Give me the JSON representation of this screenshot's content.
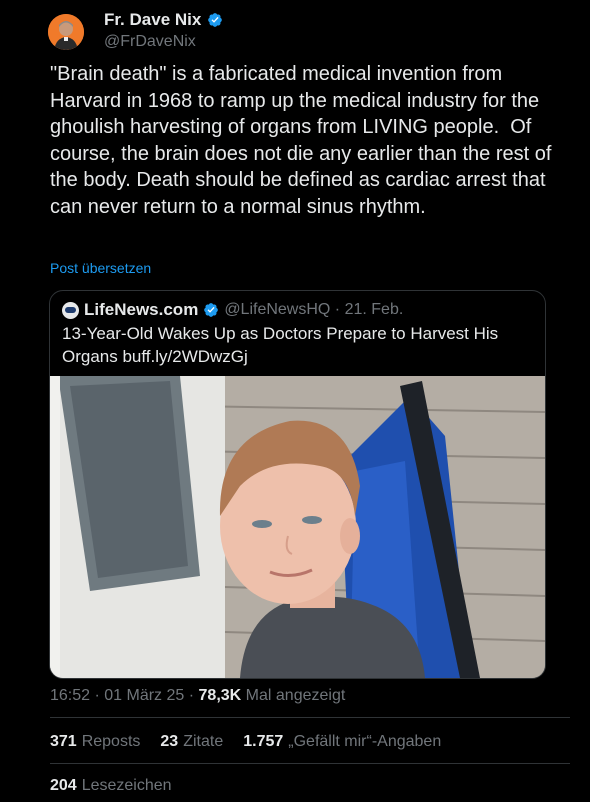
{
  "author": {
    "name": "Fr. Dave Nix",
    "handle": "@FrDaveNix",
    "avatar_icon": "avatar-portrait-icon",
    "avatar_bg": "#f07a2a",
    "verified": true
  },
  "tweet": {
    "text": "\"Brain death\" is a fabricated medical invention from Harvard in 1968 to ramp up the medical industry for the ghoulish harvesting of organs from LIVING people.  Of course, the brain does not die any earlier than the rest of the body. Death should be defined as cardiac arrest that can never return to a normal sinus rhythm.",
    "translate_label": "Post übersetzen"
  },
  "quoted": {
    "name": "LifeNews.com",
    "handle_date": "@LifeNewsHQ · 21. Feb.",
    "text": "13-Year-Old Wakes Up as Doctors Prepare to Harvest His Organs buff.ly/2WDwzGj",
    "image_icon": "boy-in-camping-chair-photo"
  },
  "meta": {
    "time_date": "16:52 · 01 März 25 · ",
    "views_count": "78,3K",
    "views_label": " Mal angezeigt"
  },
  "stats": {
    "reposts_count": "371",
    "reposts_label": "Reposts",
    "quotes_count": "23",
    "quotes_label": "Zitate",
    "likes_count": "1.757",
    "likes_label": "„Gefällt mir“-Angaben",
    "bookmarks_count": "204",
    "bookmarks_label": "Lesezeichen"
  },
  "colors": {
    "background": "#000000",
    "text": "#e7e9ea",
    "muted": "#71767b",
    "link": "#1d9bf0",
    "border": "#2f3336"
  }
}
